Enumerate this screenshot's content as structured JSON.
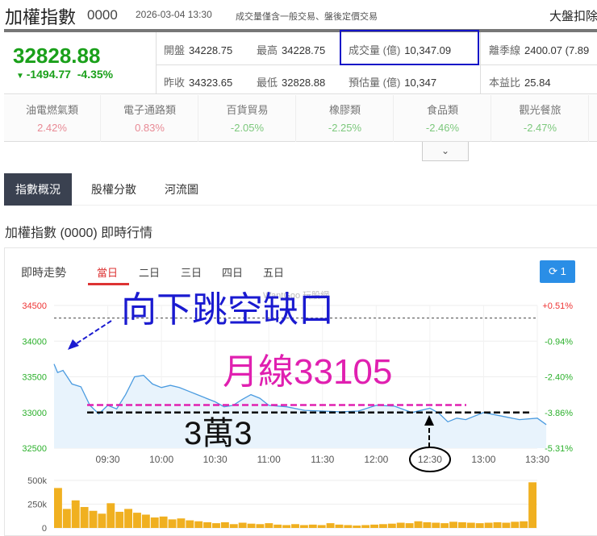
{
  "header": {
    "title": "加權指數",
    "code": "0000",
    "time": "2026-03-04 13:30",
    "note": "成交量僅含一般交易、盤後定價交易",
    "right": "大盤扣除"
  },
  "quote": {
    "price": "32828.88",
    "change": "-1494.77",
    "change_pct": "-4.35%",
    "color": "#1aa01a"
  },
  "stats": [
    {
      "label": "開盤",
      "value": "34228.75"
    },
    {
      "label": "最高",
      "value": "34228.75"
    },
    {
      "label": "成交量 (億)",
      "value": "10,347.09"
    },
    {
      "label": "離季線",
      "value": "2400.07 (7.89"
    },
    {
      "label": "昨收",
      "value": "34323.65"
    },
    {
      "label": "最低",
      "value": "32828.88"
    },
    {
      "label": "預估量 (億)",
      "value": "10,347"
    },
    {
      "label": "本益比",
      "value": "25.84"
    }
  ],
  "sectors": [
    {
      "name": "油電燃氣類",
      "value": "2.42%",
      "color": "#e88a95"
    },
    {
      "name": "電子通路類",
      "value": "0.83%",
      "color": "#e88a95"
    },
    {
      "name": "百貨貿易",
      "value": "-2.05%",
      "color": "#7cc87c"
    },
    {
      "name": "橡膠類",
      "value": "-2.25%",
      "color": "#7cc87c"
    },
    {
      "name": "食品類",
      "value": "-2.46%",
      "color": "#7cc87c"
    },
    {
      "name": "觀光餐旅",
      "value": "-2.47%",
      "color": "#7cc87c"
    }
  ],
  "expand_icon": "chevron-down-icon",
  "tabs": [
    "指數概況",
    "股權分散",
    "河流圖"
  ],
  "section_title": "加權指數 (0000) 即時行情",
  "chart_header": {
    "title": "即時走勢",
    "ranges": [
      "當日",
      "二日",
      "三日",
      "四日",
      "五日"
    ],
    "refresh_label": "1",
    "watermark": "WantGoo 玩股網"
  },
  "annotations": {
    "gap": "向下跳空缺口",
    "ma": "月線33105",
    "level": "3萬3"
  },
  "chart_data": [
    {
      "type": "line",
      "title": "即時走勢",
      "x_ticks": [
        "09:30",
        "10:00",
        "10:30",
        "11:00",
        "11:30",
        "12:00",
        "12:30",
        "13:00",
        "13:30"
      ],
      "y_ticks": [
        "34500",
        "34000",
        "33500",
        "33000",
        "32500"
      ],
      "y_right_ticks": [
        "+0.51%",
        "-0.94%",
        "-2.40%",
        "-3.86%",
        "-5.31%"
      ],
      "ylim": [
        32500,
        34500
      ],
      "xlim_minutes": [
        0,
        270
      ],
      "prev_close": 34323.65,
      "ref_lines": [
        33105,
        33000
      ],
      "x_minutes": [
        0,
        2,
        5,
        10,
        15,
        20,
        25,
        30,
        35,
        40,
        45,
        50,
        55,
        60,
        65,
        70,
        75,
        80,
        85,
        90,
        95,
        100,
        105,
        110,
        115,
        120,
        130,
        140,
        150,
        160,
        170,
        180,
        190,
        200,
        210,
        215,
        220,
        225,
        230,
        240,
        250,
        260,
        270,
        275
      ],
      "values": [
        33680,
        33560,
        33590,
        33400,
        33360,
        33100,
        32980,
        33100,
        33050,
        33250,
        33500,
        33520,
        33400,
        33350,
        33380,
        33350,
        33300,
        33250,
        33200,
        33150,
        33080,
        33100,
        33180,
        33250,
        33200,
        33100,
        33080,
        33030,
        33020,
        33010,
        33020,
        33100,
        33090,
        33000,
        33060,
        32990,
        32870,
        32920,
        32900,
        33000,
        32950,
        32900,
        32920,
        32830
      ]
    },
    {
      "type": "bar",
      "title": "成交量",
      "y_ticks": [
        "500k",
        "250k",
        "0"
      ],
      "ylim": [
        0,
        500
      ],
      "values": [
        420,
        200,
        290,
        220,
        180,
        150,
        260,
        170,
        200,
        160,
        140,
        110,
        120,
        90,
        100,
        80,
        70,
        60,
        50,
        60,
        40,
        55,
        45,
        40,
        50,
        35,
        30,
        40,
        30,
        35,
        30,
        50,
        35,
        30,
        25,
        30,
        35,
        40,
        45,
        55,
        50,
        70,
        60,
        55,
        50,
        65,
        60,
        55,
        50,
        55,
        60,
        55,
        65,
        70,
        480
      ]
    }
  ]
}
